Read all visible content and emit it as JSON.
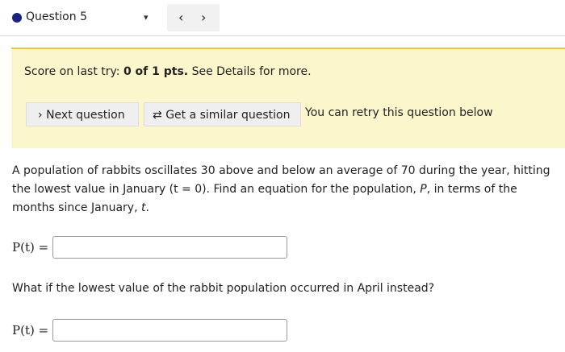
{
  "header": {
    "question_label": "Question 5",
    "dropdown_icon": "▾",
    "prev_icon": "‹",
    "next_icon": "›"
  },
  "banner": {
    "score_prefix": "Score on last try: ",
    "score_value": "0 of 1 pts.",
    "score_suffix": " See Details for more.",
    "next_question_icon": "›",
    "next_question_label": "Next question",
    "similar_icon": "⇄",
    "similar_label": "Get a similar question",
    "retry_text": "You can retry this question below"
  },
  "problem": {
    "text_part1": "A population of rabbits oscillates 30 above and below an average of 70 during the year, hitting the lowest value in January (t = 0). Find an equation for the population, ",
    "var_P": "P",
    "text_part2": ", in terms of the months since January, ",
    "var_t": "t",
    "text_part3": ".",
    "answer1_label": "P(t) =",
    "answer1_value": "",
    "question2": "What if the lowest value of the rabbit population occurred in April instead?",
    "answer2_label": "P(t) =",
    "answer2_value": ""
  }
}
